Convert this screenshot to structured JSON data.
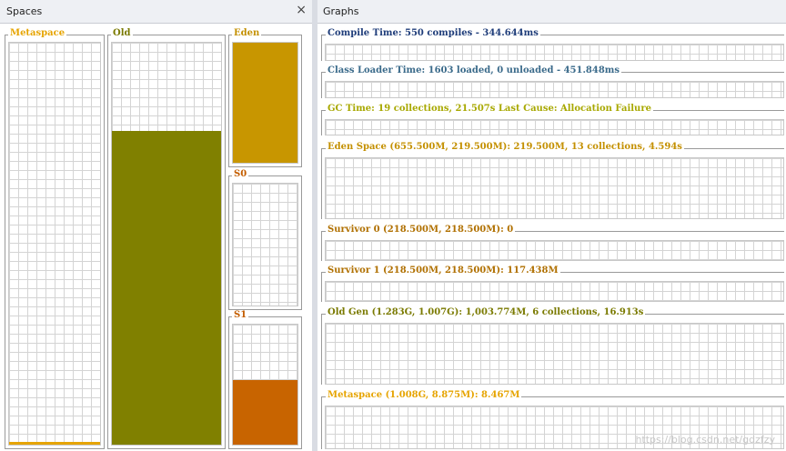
{
  "spaces_panel": {
    "title": "Spaces",
    "close_glyph": "×",
    "boxes": [
      {
        "key": "metaspace",
        "label": "Metaspace",
        "label_color": "#e6a400",
        "fill_color": "#e6a400",
        "fill_fraction": 0.006
      },
      {
        "key": "old",
        "label": "Old",
        "label_color": "#7a7a00",
        "fill_color": "#808000",
        "fill_fraction": 0.78
      },
      {
        "key": "eden",
        "label": "Eden",
        "label_color": "#c49000",
        "fill_color": "#c89600",
        "fill_fraction": 1.0
      },
      {
        "key": "s0",
        "label": "S0",
        "label_color": "#c45e00",
        "fill_color": "#c86400",
        "fill_fraction": 0.0
      },
      {
        "key": "s1",
        "label": "S1",
        "label_color": "#c45e00",
        "fill_color": "#c86400",
        "fill_fraction": 0.54
      }
    ]
  },
  "graphs_panel": {
    "title": "Graphs",
    "graphs": [
      {
        "key": "compile",
        "label": "Compile Time: 550 compiles - 344.644ms",
        "color": "#1f3d7a"
      },
      {
        "key": "classloader",
        "label": "Class Loader Time: 1603 loaded, 0 unloaded - 451.848ms",
        "color": "#3a6a8a"
      },
      {
        "key": "gc",
        "label": "GC Time: 19 collections, 21.507s  Last Cause: Allocation Failure",
        "color": "#a8a800"
      },
      {
        "key": "eden",
        "label": "Eden Space (655.500M, 219.500M): 219.500M, 13 collections, 4.594s",
        "color": "#c49000"
      },
      {
        "key": "s0",
        "label": "Survivor 0 (218.500M, 218.500M): 0",
        "color": "#b07000"
      },
      {
        "key": "s1",
        "label": "Survivor 1 (218.500M, 218.500M): 117.438M",
        "color": "#b07000"
      },
      {
        "key": "oldgen",
        "label": "Old Gen (1.283G, 1.007G): 1,003.774M, 6 collections, 16.913s",
        "color": "#7a7a00"
      },
      {
        "key": "metaspace",
        "label": "Metaspace (1.008G, 8.875M): 8.467M",
        "color": "#e6a400"
      }
    ]
  },
  "watermark": "https://blog.csdn.net/gdzfzy"
}
